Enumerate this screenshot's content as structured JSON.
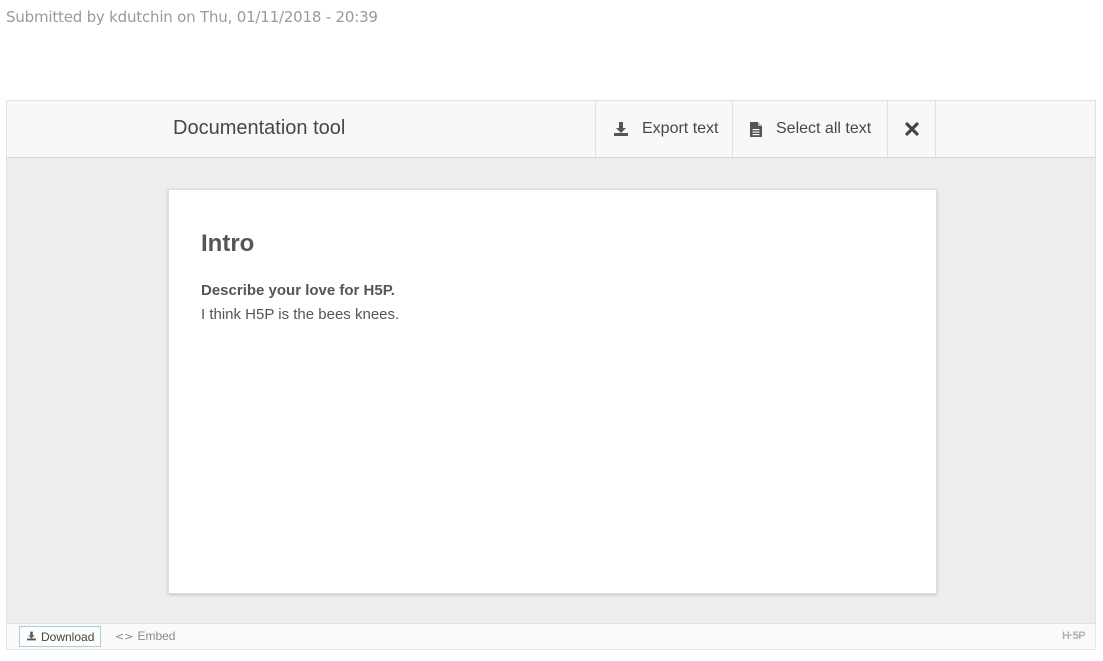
{
  "meta": {
    "submitted_text": "Submitted by kdutchin on Thu, 01/11/2018 - 20:39"
  },
  "toolbar": {
    "title": "Documentation tool",
    "export_label": "Export text",
    "select_all_label": "Select all text",
    "export_icon": "download-icon",
    "select_icon": "document-icon",
    "close_icon": "close-icon"
  },
  "page": {
    "heading": "Intro",
    "question": "Describe your love for H5P.",
    "answer": "I think H5P is the bees knees."
  },
  "actions": {
    "download_label": "Download",
    "embed_label": "Embed",
    "embed_glyph": "<>",
    "logo_text": "H·5P"
  },
  "colors": {
    "toolbar_bg": "#f8f8f8",
    "stage_bg": "#ededed",
    "text": "#474747",
    "download_border": "#a9cde3"
  }
}
